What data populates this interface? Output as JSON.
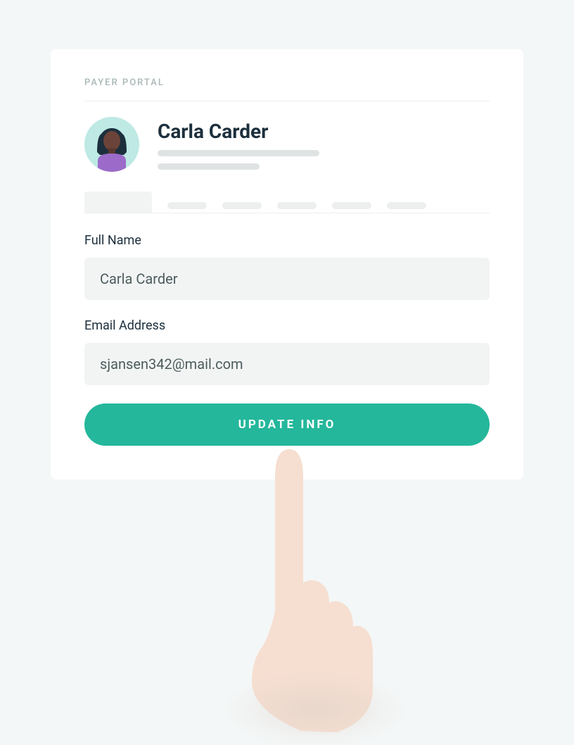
{
  "portal_label": "PAYER PORTAL",
  "profile": {
    "name": "Carla Carder"
  },
  "fields": {
    "full_name_label": "Full Name",
    "full_name_value": "Carla Carder",
    "email_label": "Email Address",
    "email_value": "sjansen342@mail.com"
  },
  "buttons": {
    "update_label": "UPDATE INFO"
  },
  "colors": {
    "accent": "#24b79b",
    "page_bg": "#f4f7f7",
    "card_bg": "#ffffff",
    "text_dark": "#1c2f3d",
    "muted": "#a9b7b7"
  }
}
